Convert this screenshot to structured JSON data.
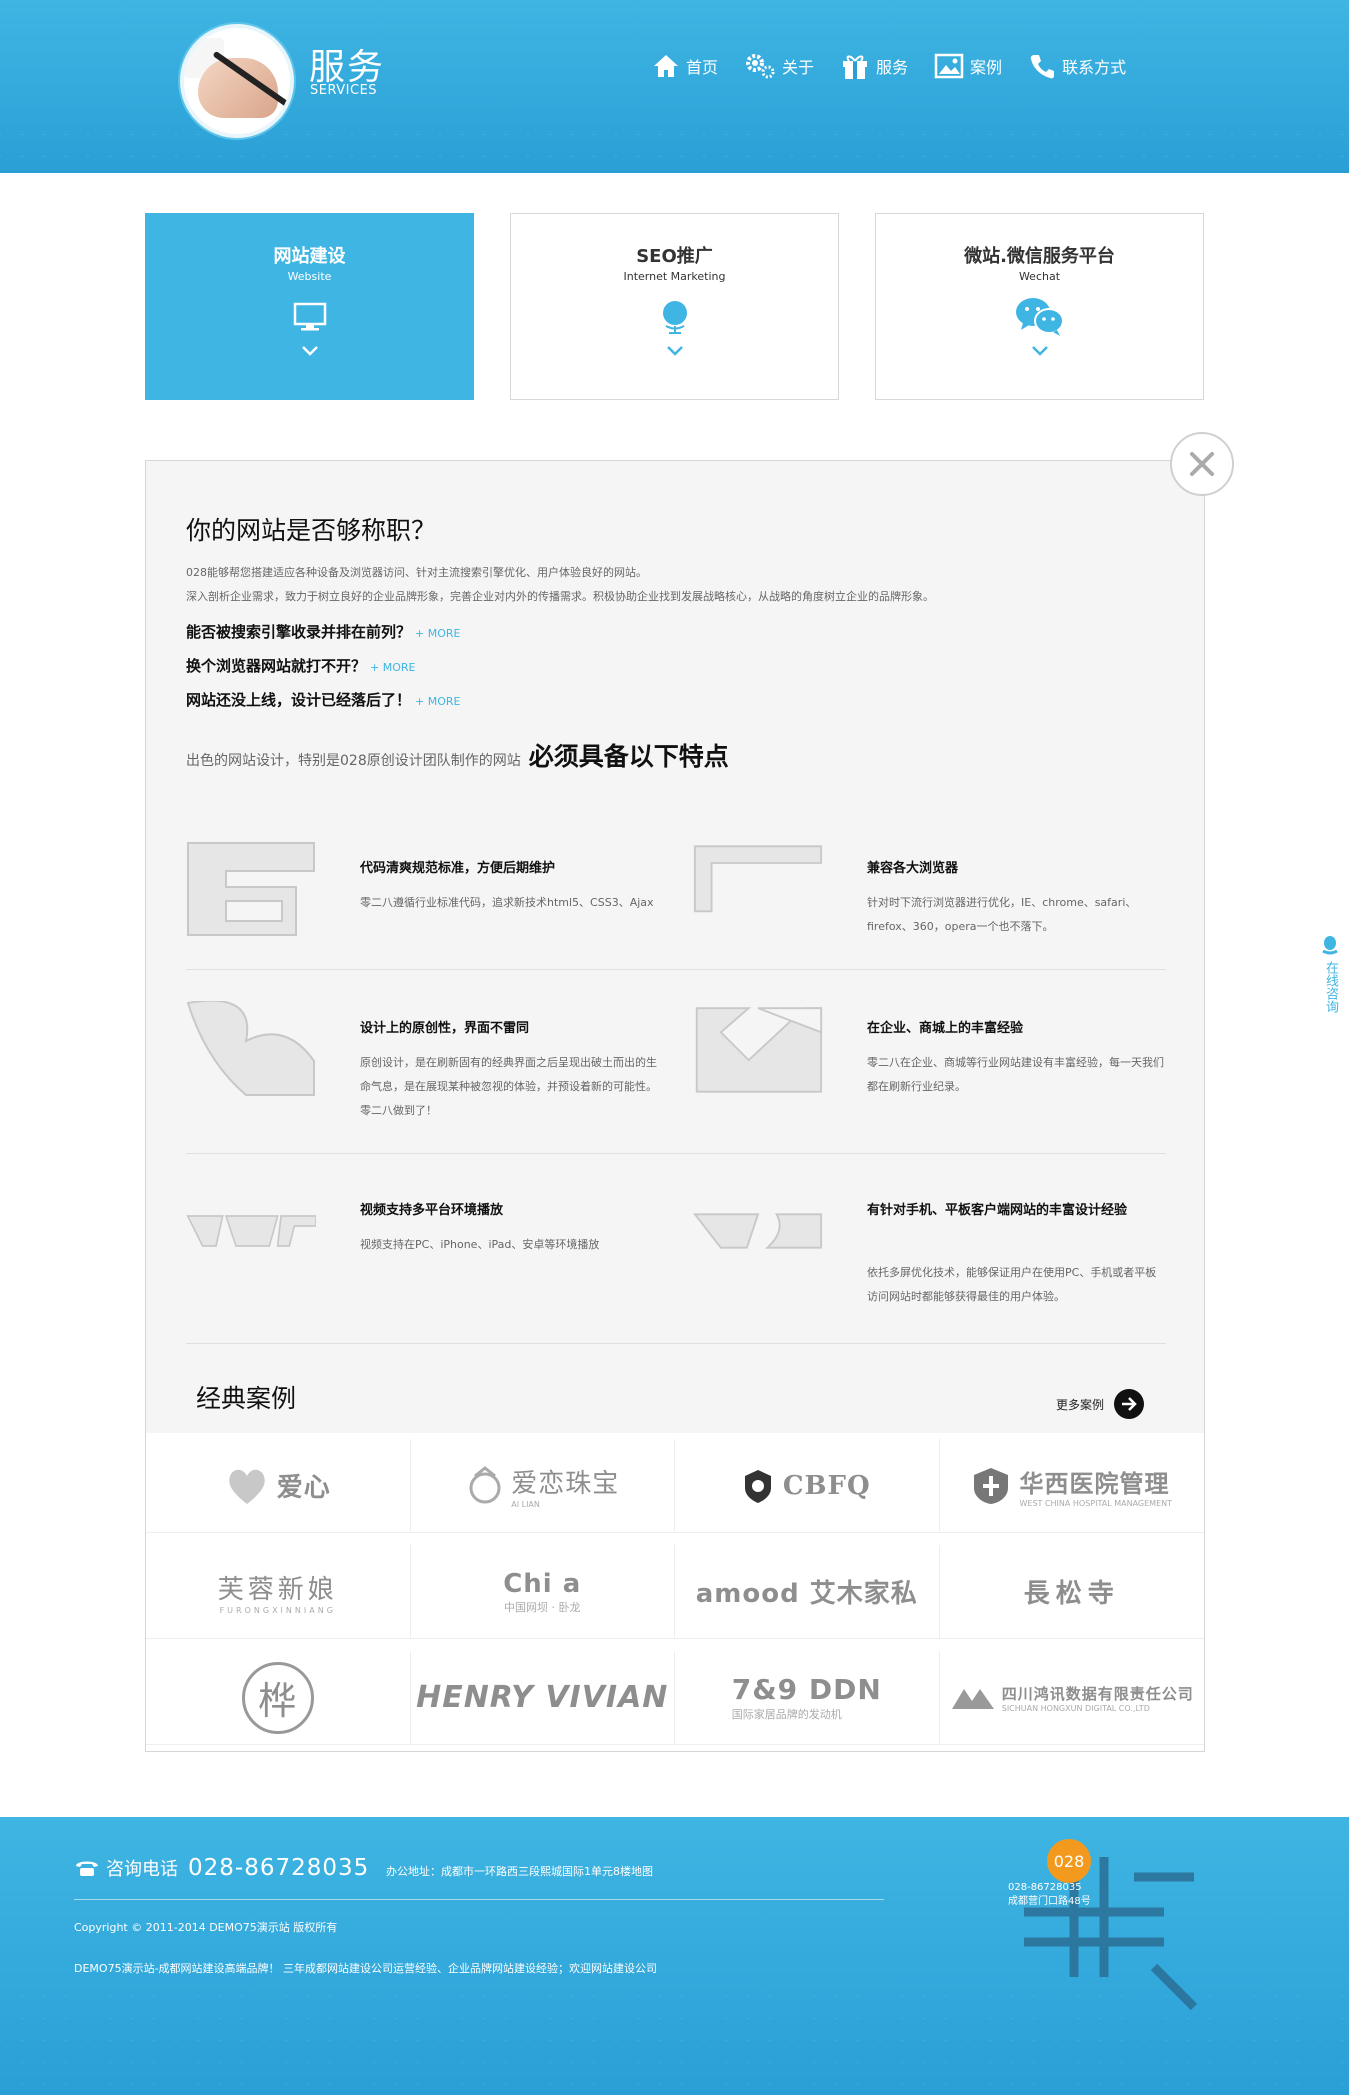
{
  "header": {
    "title": "服务",
    "subtitle": "SERVICES",
    "nav": [
      {
        "label": "首页",
        "icon": "home-icon"
      },
      {
        "label": "关于",
        "icon": "gear-icon"
      },
      {
        "label": "服务",
        "icon": "gift-icon"
      },
      {
        "label": "案例",
        "icon": "image-icon"
      },
      {
        "label": "联系方式",
        "icon": "phone-icon"
      }
    ]
  },
  "cards": [
    {
      "title": "网站建设",
      "subtitle": "Website",
      "icon": "monitor-icon",
      "active": true
    },
    {
      "title": "SEO推广",
      "subtitle": "Internet Marketing",
      "icon": "globe-icon",
      "active": false
    },
    {
      "title": "微站.微信服务平台",
      "subtitle": "Wechat",
      "icon": "wechat-icon",
      "active": false
    }
  ],
  "panel": {
    "title": "你的网站是否够称职？",
    "intro_1": "028能够帮您搭建适应各种设备及浏览器访问、针对主流搜索引擎优化、用户体验良好的网站。",
    "intro_2": "深入剖析企业需求，致力于树立良好的企业品牌形象，完善企业对内外的传播需求。积极协助企业找到发展战略核心，从战略的角度树立企业的品牌形象。",
    "questions": [
      {
        "text": "能否被搜索引擎收录并排在前列？",
        "more": "+ MORE"
      },
      {
        "text": "换个浏览器网站就打不开？",
        "more": "+ MORE"
      },
      {
        "text": "网站还没上线，设计已经落后了！",
        "more": "+ MORE"
      }
    ],
    "must_lead": "出色的网站设计，特别是028原创设计团队制作的网站",
    "must_strong": "必须具备以下特点",
    "features": [
      {
        "title": "代码清爽规范标准，方便后期维护",
        "desc": "零二八遵循行业标准代码，追求新技术html5、CSS3、Ajax"
      },
      {
        "title": "兼容各大浏览器",
        "desc": "针对时下流行浏览器进行优化，IE、chrome、safari、firefox、360，opera一个也不落下。"
      },
      {
        "title": "设计上的原创性，界面不雷同",
        "desc": "原创设计，是在刷新固有的经典界面之后呈现出破土而出的生命气息，是在展现某种被忽视的体验，并预设着新的可能性。零二八做到了！"
      },
      {
        "title": "在企业、商城上的丰富经验",
        "desc": "零二八在企业、商城等行业网站建设有丰富经验，每一天我们都在刷新行业纪录。"
      },
      {
        "title": "视频支持多平台环境播放",
        "desc": "视频支持在PC、iPhone、iPad、安卓等环境播放"
      },
      {
        "title": "有针对手机、平板客户端网站的丰富设计经验",
        "desc": "依托多屏优化技术，能够保证用户在使用PC、手机或者平板访问网站时都能够获得最佳的用户体验。"
      }
    ],
    "cases_title": "经典案例",
    "more_cases": "更多案例",
    "logos": [
      {
        "name": "爱心",
        "sub": ""
      },
      {
        "name": "爱恋珠宝",
        "sub": "AI LIAN"
      },
      {
        "name": "CBFQ",
        "sub": ""
      },
      {
        "name": "华西医院管理",
        "sub": "WEST CHINA HOSPITAL MANAGEMENT"
      },
      {
        "name": "芙蓉新娘",
        "sub": "FURONGXINNIANG"
      },
      {
        "name": "Chi a",
        "sub": "中国网坝 · 卧龙"
      },
      {
        "name": "amood 艾木家私",
        "sub": ""
      },
      {
        "name": "長松寺",
        "sub": ""
      },
      {
        "name": "桦",
        "sub": ""
      },
      {
        "name": "HENRY VIVIAN",
        "sub": ""
      },
      {
        "name": "7&9 DDN",
        "sub": "国际家居品牌的发动机"
      },
      {
        "name": "四川鸿讯数据有限责任公司",
        "sub": "SICHUAN HONGXUN DIGITAL CO.,LTD"
      }
    ]
  },
  "side_consult": "在线咨询",
  "footer": {
    "phone_label": "咨询电话",
    "phone": "028-86728035",
    "address": "办公地址：成都市一环路西三段熙城国际1单元8楼地图",
    "copyright": "Copyright © 2011-2014 DEMO75演示站 版权所有",
    "slogan": "DEMO75演示站-成都网站建设高端品牌！ 三年成都网站建设公司运营经验、企业品牌网站建设经验；欢迎网站建设公司",
    "badge": "028",
    "map_phone": "028-86728035",
    "map_addr": "成都营门口路48号"
  },
  "colors": {
    "accent": "#3fb5e3",
    "dark": "#111111",
    "footer_badge": "#f39a1e"
  }
}
